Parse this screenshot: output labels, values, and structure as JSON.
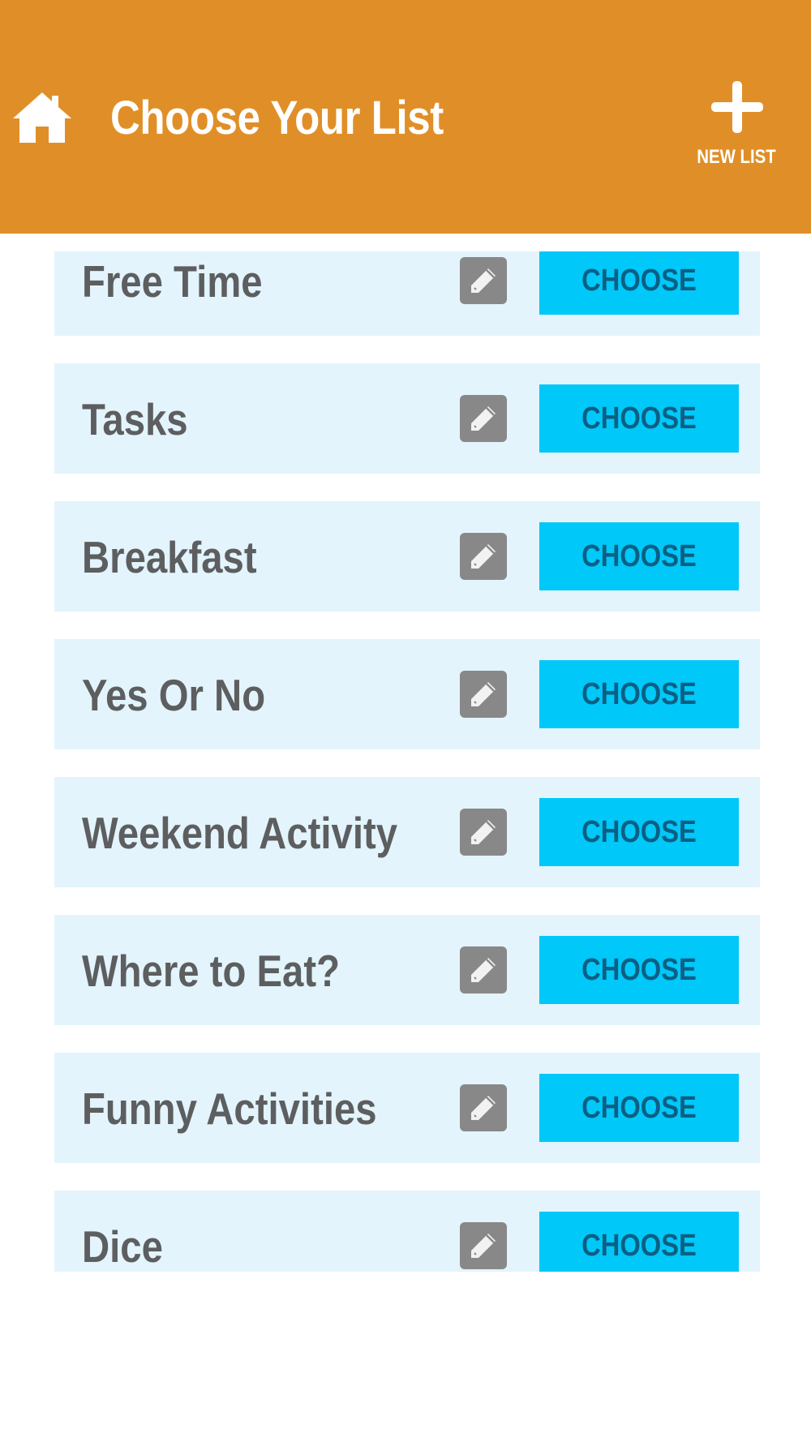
{
  "header": {
    "title": "Choose Your List",
    "new_list_label": "NEW LIST",
    "home_icon": "home-icon",
    "new_icon": "plus-icon",
    "background_color": "#e08f28"
  },
  "lists": {
    "choose_label": "CHOOSE",
    "items": [
      {
        "name": "Free Time"
      },
      {
        "name": "Tasks"
      },
      {
        "name": "Breakfast"
      },
      {
        "name": "Yes Or No"
      },
      {
        "name": "Weekend Activity"
      },
      {
        "name": "Where to Eat?"
      },
      {
        "name": "Funny Activities"
      },
      {
        "name": "Dice"
      }
    ],
    "edit_icon": "pencil-icon",
    "row_color": "#e3f4fc",
    "button_color": "#00c8f8",
    "button_text_color": "#0c5f84"
  }
}
